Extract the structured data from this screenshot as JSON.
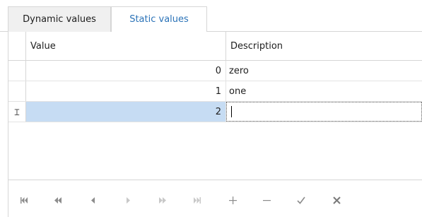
{
  "tabs": [
    {
      "label": "Dynamic values",
      "active": false
    },
    {
      "label": "Static values",
      "active": true
    }
  ],
  "grid": {
    "columns": [
      "Value",
      "Description"
    ],
    "rows": [
      {
        "value": "0",
        "description": "zero"
      },
      {
        "value": "1",
        "description": "one"
      },
      {
        "value": "2",
        "description": ""
      }
    ],
    "selected_row": 2
  },
  "navigator": {
    "buttons": [
      {
        "name": "first-record",
        "glyph": "⏮"
      },
      {
        "name": "prev-page",
        "glyph": "⏪"
      },
      {
        "name": "prev-record",
        "glyph": "◂"
      },
      {
        "name": "next-record",
        "glyph": "▸"
      },
      {
        "name": "next-page",
        "glyph": "⏩"
      },
      {
        "name": "last-record",
        "glyph": "⏭"
      },
      {
        "name": "append",
        "glyph": "+"
      },
      {
        "name": "delete",
        "glyph": "−"
      },
      {
        "name": "end-edit",
        "glyph": "✓"
      },
      {
        "name": "cancel-edit",
        "glyph": "✕"
      }
    ]
  },
  "colors": {
    "active_tab_text": "#2b73b8",
    "selection": "#c6dcf3",
    "border": "#d6d6d6"
  }
}
